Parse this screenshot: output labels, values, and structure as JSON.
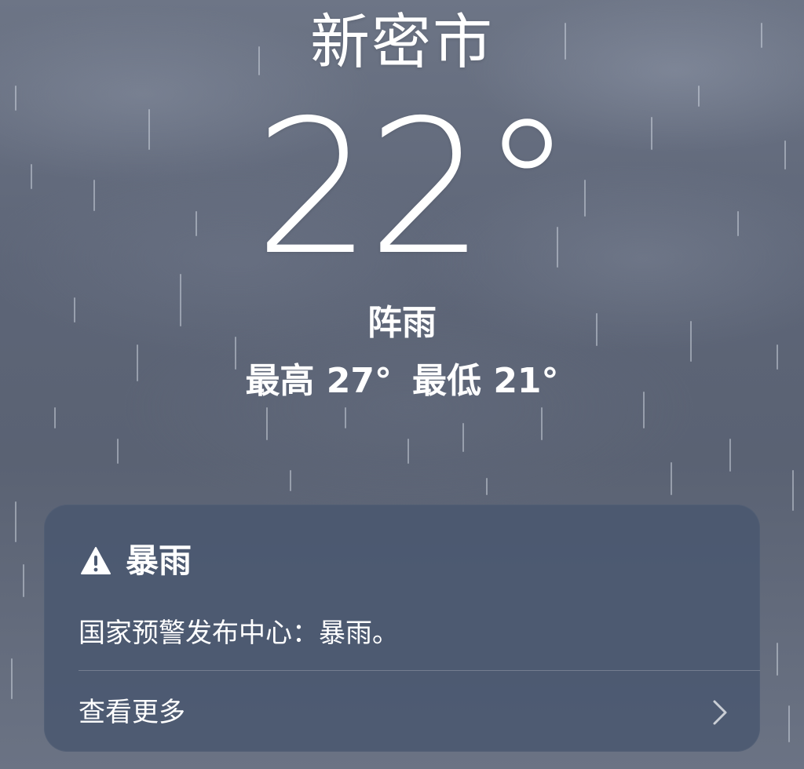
{
  "weather": {
    "city": "新密市",
    "temperature": "22°",
    "condition": "阵雨",
    "high": "最高 27°",
    "low": "最低 21°"
  },
  "alert": {
    "icon": "warning-triangle-icon",
    "title": "暴雨",
    "message": "国家预警发布中心：暴雨。",
    "more_label": "查看更多",
    "more_icon": "chevron-right-icon"
  },
  "colors": {
    "background": "#5d6577",
    "card": "#4a5870",
    "text": "#ffffff"
  }
}
